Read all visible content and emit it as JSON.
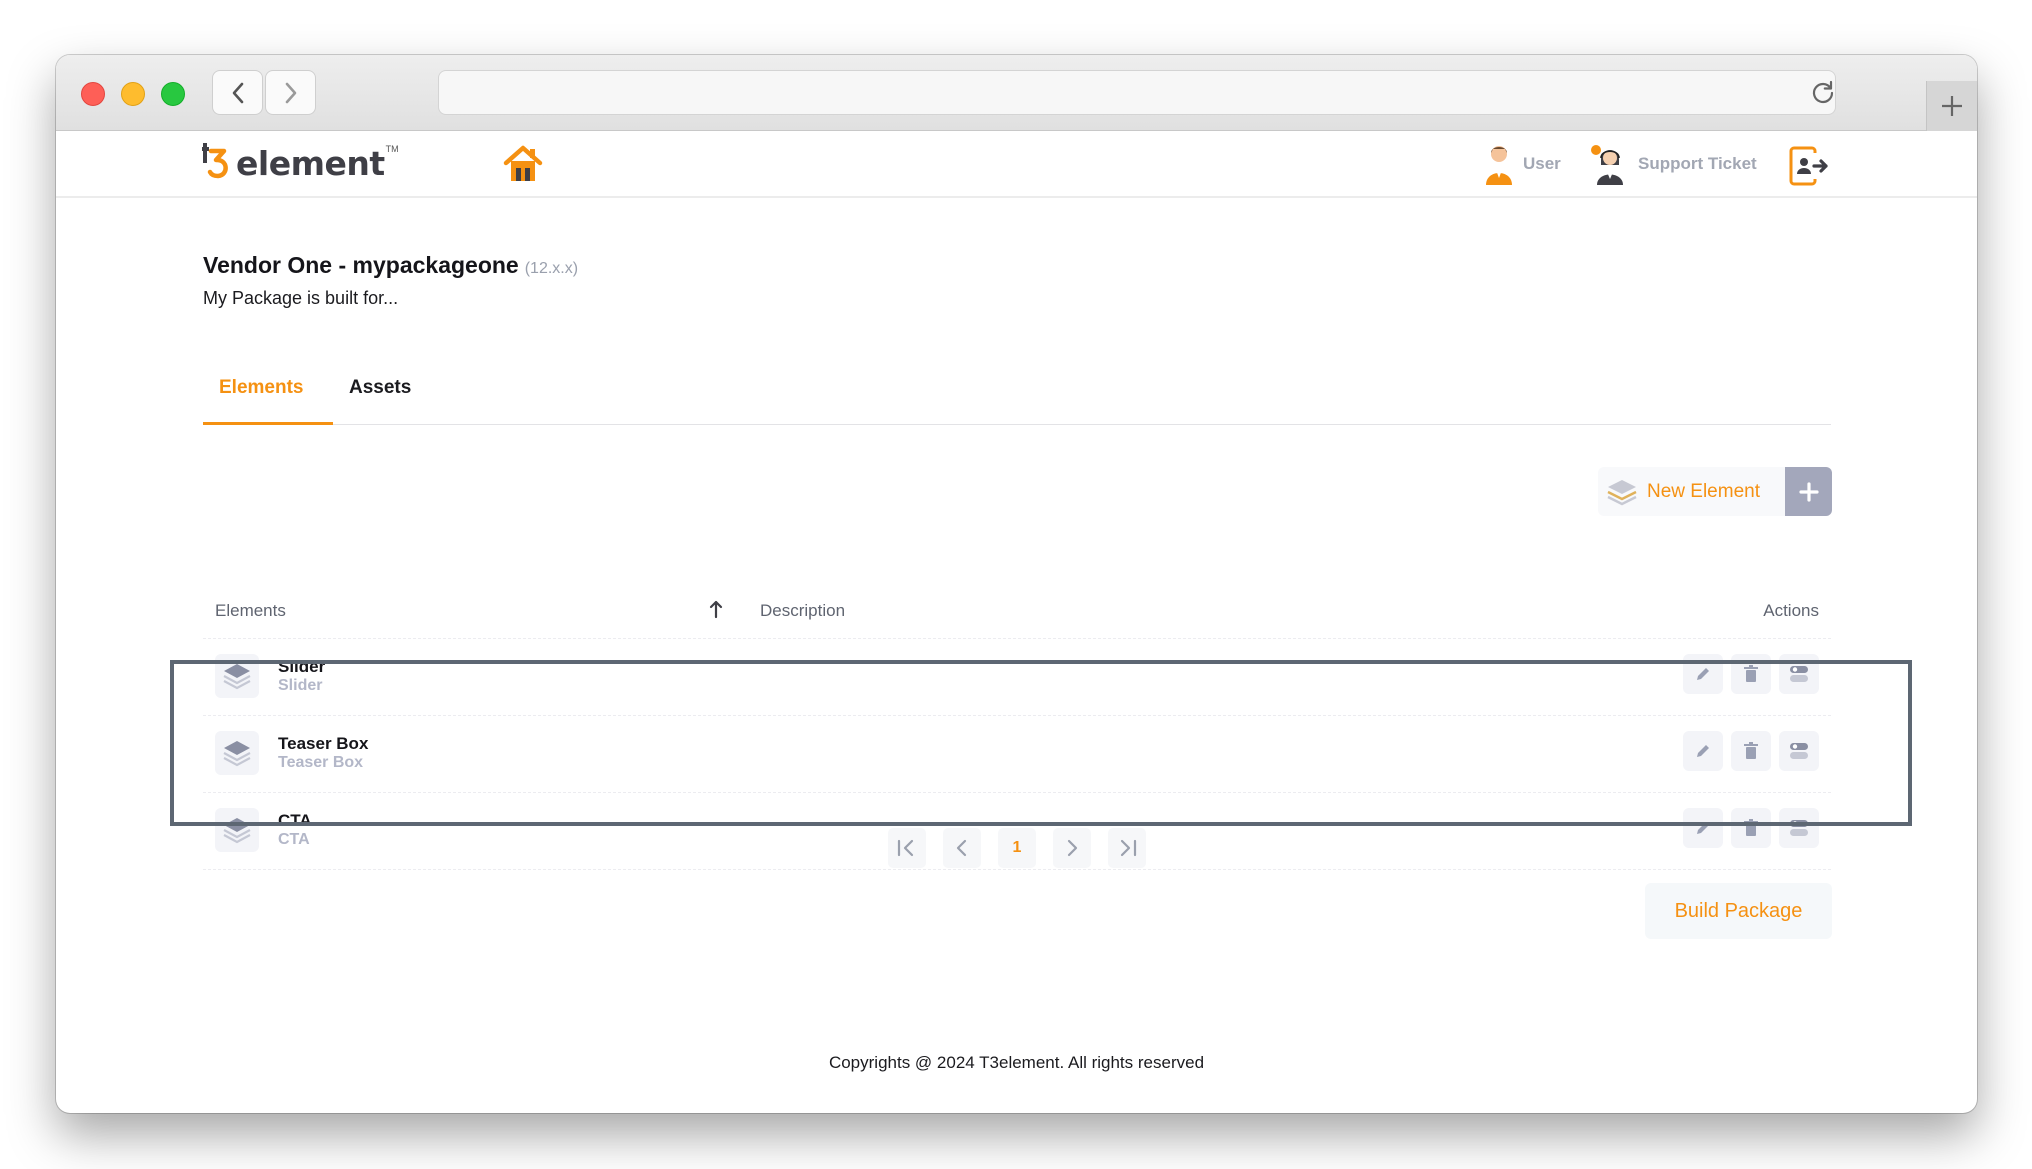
{
  "browser": {
    "url": "",
    "icons": [
      "chevron-left-icon",
      "chevron-right-icon",
      "reload-icon",
      "plus-icon"
    ]
  },
  "header": {
    "logo_text": "element",
    "logo_tm": "TM",
    "user_label": "User",
    "support_label": "Support Ticket"
  },
  "page": {
    "title": "Vendor One - mypackageone",
    "version": "(12.x.x)",
    "subtitle": "My Package is built for..."
  },
  "tabs": [
    {
      "label": "Elements",
      "active": true
    },
    {
      "label": "Assets",
      "active": false
    }
  ],
  "toolbar": {
    "new_element_label": "New Element"
  },
  "table": {
    "columns": {
      "elements": "Elements",
      "description": "Description",
      "actions": "Actions"
    },
    "rows": [
      {
        "name": "Slider",
        "sub": "Slider"
      },
      {
        "name": "Teaser Box",
        "sub": "Teaser Box"
      },
      {
        "name": "CTA",
        "sub": "CTA"
      }
    ]
  },
  "pagination": {
    "current_page": "1"
  },
  "build_label": "Build Package",
  "footer": "Copyrights @ 2024 T3element. All rights reserved",
  "colors": {
    "accent": "#f59112",
    "muted": "#a3a7bb",
    "highlight_border": "#5d6773"
  }
}
